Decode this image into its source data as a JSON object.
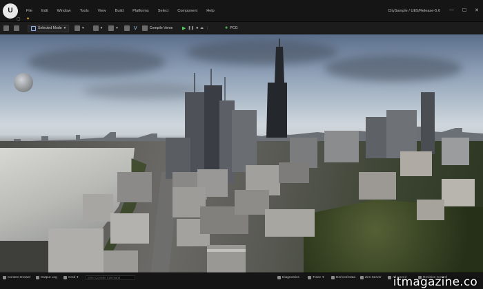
{
  "titlebar": {
    "logo": "U",
    "menu": [
      "File",
      "Edit",
      "Window",
      "Tools",
      "View",
      "Build",
      "Platforms",
      "Select",
      "Component",
      "Help"
    ],
    "project": "CitySample / UE5/Release-5.6",
    "window_controls": [
      "—",
      "☐",
      "✕"
    ]
  },
  "toolbar": {
    "save_icon": "save-icon",
    "mode_label": "Selected Mode",
    "compile_label": "Compile Verse",
    "pcg_label": "PCG"
  },
  "statusbar": {
    "content_drawer": "Content Drawer",
    "output_log": "Output Log",
    "cmd": "Cmd",
    "cmd_placeholder": "Enter Console Command",
    "diagnostics": "Diagnostics",
    "trace": "Trace",
    "derived_data": "Derived Data",
    "zen_server": "Zen Server",
    "unsaved": "All Saved",
    "revision_control": "Revision Control"
  },
  "watermark": "itmagazine.co",
  "colors": {
    "titlebar": "#151515",
    "toolbar": "#1c1c1c",
    "play_green": "#4bd05a"
  }
}
